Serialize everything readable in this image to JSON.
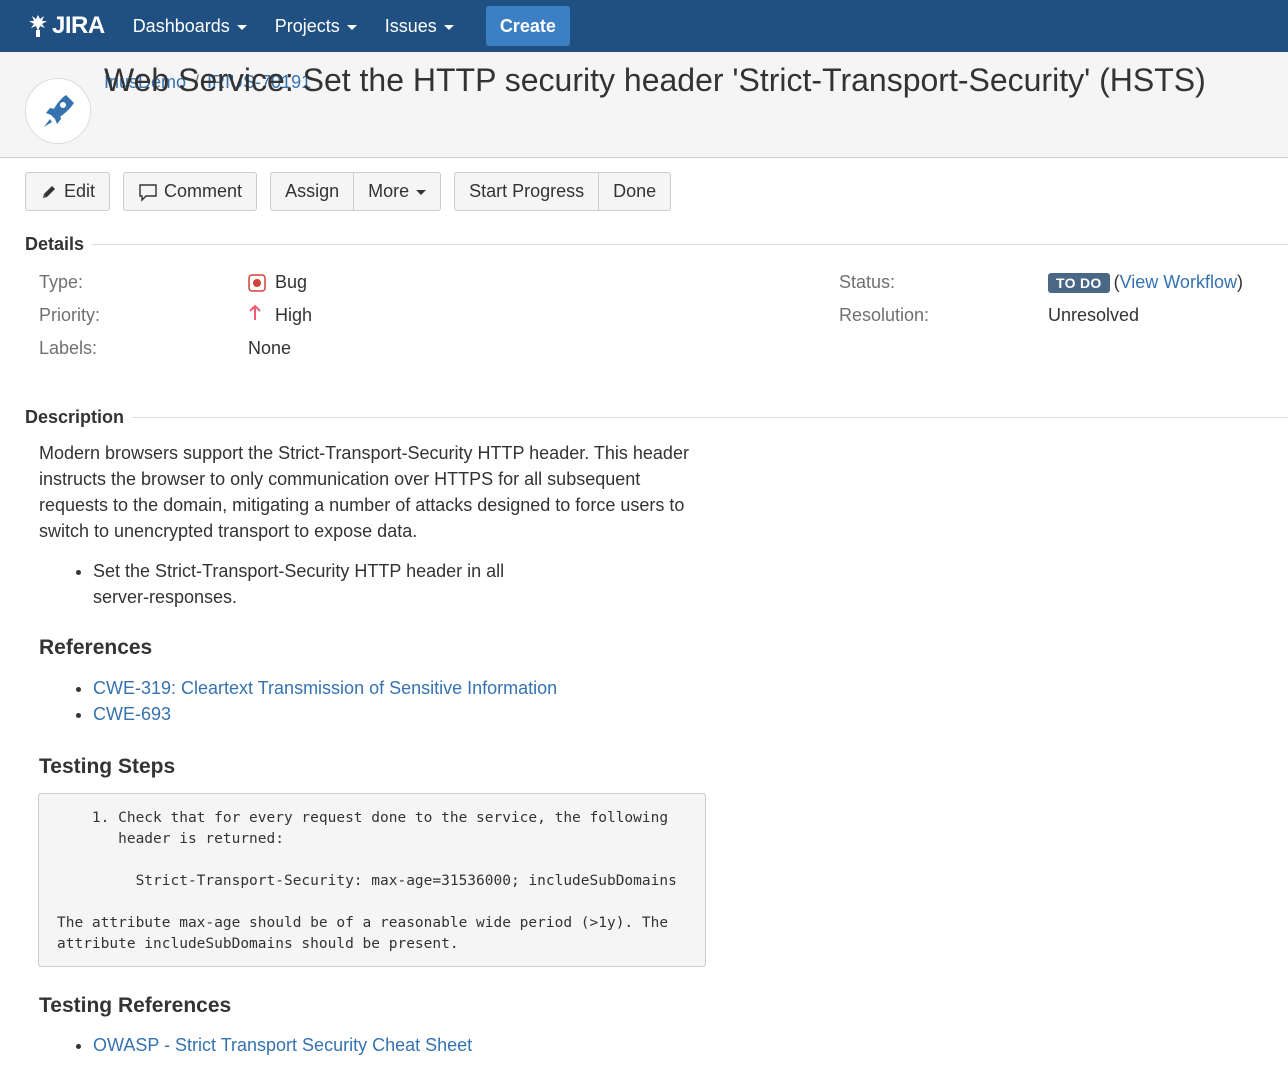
{
  "nav": {
    "logo_text": "JIRA",
    "items": [
      {
        "label": "Dashboards"
      },
      {
        "label": "Projects"
      },
      {
        "label": "Issues"
      }
    ],
    "create_label": "Create"
  },
  "breadcrumb": {
    "project": "IriusDemo",
    "separator": "/",
    "issue_key": "IRIUS-70191"
  },
  "issue": {
    "title": "Web Service: Set the HTTP security header 'Strict-Transport-Security' (HSTS)"
  },
  "toolbar": {
    "edit": "Edit",
    "comment": "Comment",
    "assign": "Assign",
    "more": "More",
    "start_progress": "Start Progress",
    "done": "Done"
  },
  "details": {
    "heading": "Details",
    "type_label": "Type:",
    "type_value": "Bug",
    "priority_label": "Priority:",
    "priority_value": "High",
    "labels_label": "Labels:",
    "labels_value": "None",
    "status_label": "Status:",
    "status_value": "TO DO",
    "status_open_paren": "(",
    "view_workflow": "View Workflow",
    "status_close_paren": ")",
    "resolution_label": "Resolution:",
    "resolution_value": "Unresolved"
  },
  "description": {
    "heading": "Description",
    "paragraph": "Modern browsers support the Strict-Transport-Security HTTP header. This header instructs the browser to only communication over HTTPS for all subsequent requests to the domain, mitigating a number of attacks designed to force users to switch to unencrypted transport to expose data.",
    "bullets": [
      "Set the Strict-Transport-Security HTTP header in all server-responses."
    ],
    "references_heading": "References",
    "references": [
      "CWE-319: Cleartext Transmission of Sensitive Information",
      "CWE-693"
    ],
    "testing_steps_heading": "Testing Steps",
    "testing_steps_code": "    1. Check that for every request done to the service, the following\n       header is returned:\n\n         Strict-Transport-Security: max-age=31536000; includeSubDomains\n\nThe attribute max-age should be of a reasonable wide period (>1y). The\nattribute includeSubDomains should be present.",
    "testing_references_heading": "Testing References",
    "testing_references": [
      "OWASP - Strict Transport Security Cheat Sheet"
    ]
  },
  "colors": {
    "nav_bg": "#205081",
    "create_bg": "#3b7fc4",
    "link": "#3572b0",
    "status_badge": "#4a6785",
    "bug_red": "#d04437",
    "priority_red": "#f15c75"
  },
  "icons": {
    "logo": "jira-logo-icon",
    "avatar": "rocket-icon",
    "edit": "pencil-icon",
    "comment": "comment-bubble-icon",
    "type": "bug-icon",
    "priority": "arrow-up-icon"
  }
}
